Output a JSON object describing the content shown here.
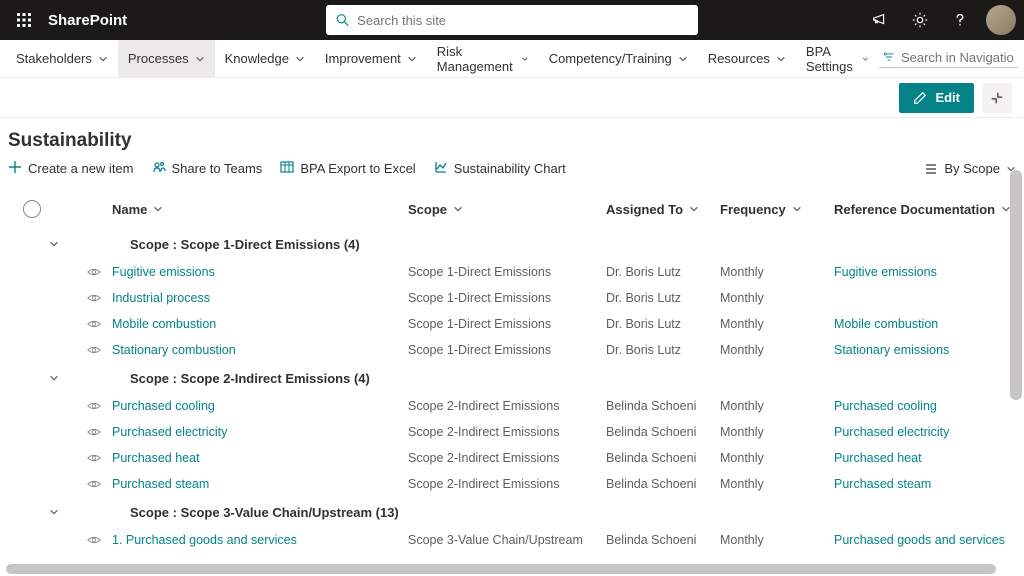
{
  "brand": "SharePoint",
  "search": {
    "placeholder": "Search this site"
  },
  "nav": {
    "items": [
      {
        "label": "Stakeholders"
      },
      {
        "label": "Processes",
        "active": true
      },
      {
        "label": "Knowledge"
      },
      {
        "label": "Improvement"
      },
      {
        "label": "Risk Management"
      },
      {
        "label": "Competency/Training"
      },
      {
        "label": "Resources"
      },
      {
        "label": "BPA Settings"
      }
    ],
    "search_placeholder": "Search in Navigation"
  },
  "edit": {
    "label": "Edit"
  },
  "page": {
    "title": "Sustainability"
  },
  "commands": {
    "create": "Create a new item",
    "share": "Share to Teams",
    "export": "BPA Export to Excel",
    "chart": "Sustainability Chart",
    "view": "By Scope"
  },
  "columns": {
    "name": "Name",
    "scope": "Scope",
    "assigned": "Assigned To",
    "frequency": "Frequency",
    "ref": "Reference Documentation"
  },
  "groups": [
    {
      "label": "Scope : Scope 1-Direct Emissions (4)",
      "rows": [
        {
          "name": "Fugitive emissions",
          "scope": "Scope 1-Direct Emissions",
          "assigned": "Dr. Boris Lutz",
          "freq": "Monthly",
          "ref": "Fugitive emissions"
        },
        {
          "name": "Industrial process",
          "scope": "Scope 1-Direct Emissions",
          "assigned": "Dr. Boris Lutz",
          "freq": "Monthly",
          "ref": ""
        },
        {
          "name": "Mobile combustion",
          "scope": "Scope 1-Direct Emissions",
          "assigned": "Dr. Boris Lutz",
          "freq": "Monthly",
          "ref": "Mobile combustion"
        },
        {
          "name": "Stationary combustion",
          "scope": "Scope 1-Direct Emissions",
          "assigned": "Dr. Boris Lutz",
          "freq": "Monthly",
          "ref": "Stationary emissions"
        }
      ]
    },
    {
      "label": "Scope : Scope 2-Indirect Emissions (4)",
      "rows": [
        {
          "name": "Purchased cooling",
          "scope": "Scope 2-Indirect Emissions",
          "assigned": "Belinda Schoeni",
          "freq": "Monthly",
          "ref": "Purchased cooling"
        },
        {
          "name": "Purchased electricity",
          "scope": "Scope 2-Indirect Emissions",
          "assigned": "Belinda Schoeni",
          "freq": "Monthly",
          "ref": "Purchased electricity"
        },
        {
          "name": "Purchased heat",
          "scope": "Scope 2-Indirect Emissions",
          "assigned": "Belinda Schoeni",
          "freq": "Monthly",
          "ref": "Purchased heat"
        },
        {
          "name": "Purchased steam",
          "scope": "Scope 2-Indirect Emissions",
          "assigned": "Belinda Schoeni",
          "freq": "Monthly",
          "ref": "Purchased steam"
        }
      ]
    },
    {
      "label": "Scope : Scope 3-Value Chain/Upstream (13)",
      "rows": [
        {
          "name": "1. Purchased goods and services",
          "scope": "Scope 3-Value Chain/Upstream",
          "assigned": "Belinda Schoeni",
          "freq": "Monthly",
          "ref": "Purchased goods and services"
        }
      ]
    }
  ]
}
